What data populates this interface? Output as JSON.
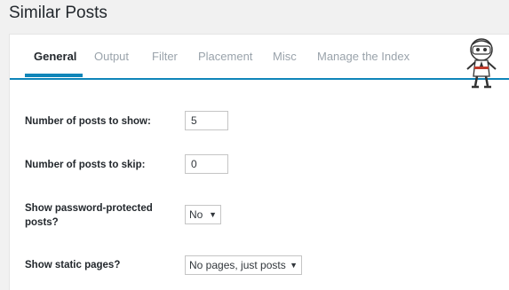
{
  "page": {
    "title": "Similar Posts"
  },
  "tabs": [
    {
      "label": "General",
      "active": true
    },
    {
      "label": "Output"
    },
    {
      "label": "Filter"
    },
    {
      "label": "Placement"
    },
    {
      "label": "Misc"
    },
    {
      "label": "Manage the Index"
    }
  ],
  "form": {
    "posts_to_show": {
      "label": "Number of posts to show:",
      "value": "5"
    },
    "posts_to_skip": {
      "label": "Number of posts to skip:",
      "value": "0"
    },
    "password_protected": {
      "label": "Show password-protected posts?",
      "selected": "No"
    },
    "static_pages": {
      "label": "Show static pages?",
      "selected": "No pages, just posts"
    }
  },
  "colors": {
    "accent": "#0f85b9",
    "inactive_tab": "#9aa3ab",
    "background": "#f1f1f1"
  },
  "icons": {
    "caret": "dropdown-caret-icon",
    "mascot": "ninja-mascot-icon"
  }
}
